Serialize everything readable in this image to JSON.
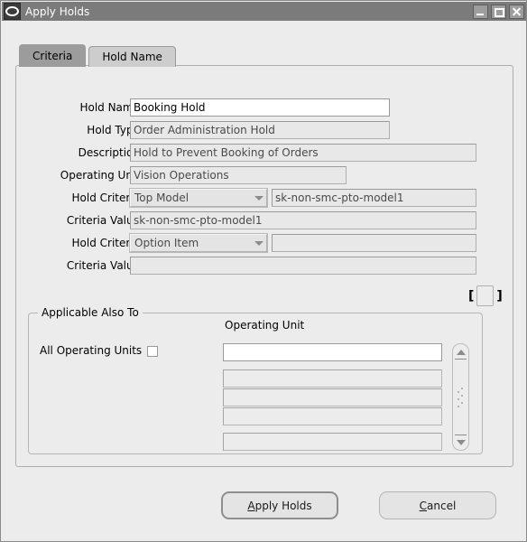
{
  "window": {
    "title": "Apply Holds",
    "icon": "oracle-oval-icon",
    "controls": {
      "minimize": "minimize-icon",
      "maximize": "maximize-icon",
      "close": "close-icon"
    }
  },
  "tabs": [
    {
      "label": "Criteria",
      "selected": true
    },
    {
      "label": "Hold Name",
      "selected": false
    }
  ],
  "form": {
    "hold_name": {
      "label": "Hold Name",
      "value": "Booking Hold",
      "editable": true
    },
    "hold_type": {
      "label": "Hold Type",
      "value": "Order Administration Hold",
      "editable": false
    },
    "description": {
      "label": "Description",
      "value": "Hold to Prevent Booking of Orders",
      "editable": false
    },
    "operating_unit": {
      "label": "Operating Unit",
      "value": "Vision Operations",
      "editable": false
    },
    "hold_criteria_1": {
      "label": "Hold Criteria",
      "value": "Top Model",
      "detail": "sk-non-smc-pto-model1"
    },
    "criteria_value_1": {
      "label": "Criteria Value",
      "value": "sk-non-smc-pto-model1"
    },
    "hold_criteria_2": {
      "label": "Hold Criteria",
      "value": "Option Item",
      "detail": ""
    },
    "criteria_value_2": {
      "label": "Criteria Value",
      "value": ""
    }
  },
  "lov": {
    "left_bracket": "[",
    "right_bracket": "]",
    "button_label": ""
  },
  "applicable": {
    "group_title": "Applicable Also To",
    "column_header": "Operating Unit",
    "checkbox_label": "All Operating Units",
    "checkbox_checked": false,
    "rows": [
      "",
      "",
      "",
      "",
      ""
    ]
  },
  "scrollbar": {
    "up_arrow": "scroll-up-icon",
    "down_arrow": "scroll-down-icon"
  },
  "buttons": {
    "apply": {
      "pre": "",
      "mnemonic": "A",
      "post": "pply Holds",
      "default": true
    },
    "cancel": {
      "pre": "",
      "mnemonic": "C",
      "post": "ancel",
      "default": false
    }
  },
  "colors": {
    "titlebar": "#7b7b7b",
    "window_bg": "#ececec",
    "tab_selected": "#9c9c9c",
    "tab_unselected": "#cdcdcd",
    "field_readonly": "#e8e8e8",
    "field_editable": "#ffffff"
  }
}
